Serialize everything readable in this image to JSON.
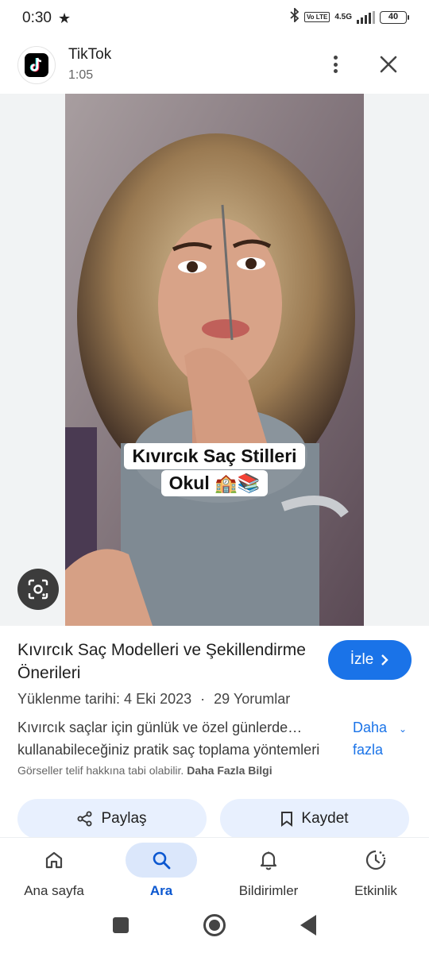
{
  "status_bar": {
    "time": "0:30",
    "star": "★",
    "network": "4.5G",
    "volte": "Vo LTE",
    "battery": "40"
  },
  "header": {
    "title": "TikTok",
    "duration": "1:05"
  },
  "media": {
    "caption_line1": "Kıvırcık Saç Stilleri",
    "caption_line2": "Okul 🏫📚"
  },
  "result": {
    "title": "Kıvırcık Saç Modelleri ve Şekillendirme Önerileri",
    "watch_label": "İzle",
    "uploaded": "Yüklenme tarihi: 4 Eki 2023",
    "separator": "·",
    "comments": "29 Yorumlar",
    "description": "Kıvırcık saçlar için günlük ve özel günlerde… kullanabileceğiniz pratik saç toplama yöntemleri",
    "more_label": "Daha fazla",
    "copyright_text": "Görseller telif hakkına tabi olabilir.",
    "copyright_link": "Daha Fazla Bilgi"
  },
  "actions": {
    "share_label": "Paylaş",
    "save_label": "Kaydet"
  },
  "bottom_nav": {
    "items": [
      {
        "label": "Ana sayfa",
        "icon": "home-icon"
      },
      {
        "label": "Ara",
        "icon": "search-icon",
        "active": true
      },
      {
        "label": "Bildirimler",
        "icon": "bell-icon"
      },
      {
        "label": "Etkinlik",
        "icon": "activity-icon"
      }
    ]
  },
  "colors": {
    "accent": "#1a73e8",
    "pill_bg": "#e8f0fe",
    "active_nav_bg": "#dbe7fb",
    "active_nav_text": "#0b57d0"
  }
}
